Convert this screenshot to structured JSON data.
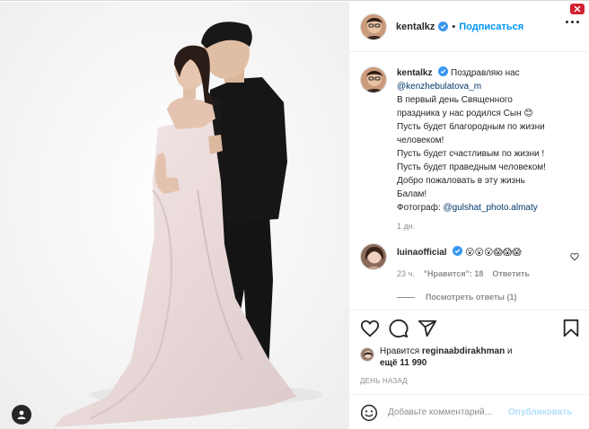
{
  "header": {
    "username": "kentalkz",
    "follow_label": "Подписаться",
    "separator": "•"
  },
  "caption": {
    "username": "kentalkz",
    "text_before_mention": "Поздравляю нас",
    "mention": "@kenzhebulatova_m",
    "lines": [
      "В первый день Священного",
      "праздника у нас родился Сын 😊",
      "Пусть будет благородным по жизни",
      "человеком!",
      "Пусть будет счастливым по жизни !",
      "Пусть будет праведным человеком!",
      "Добро пожаловать в эту жизнь",
      "Балам!"
    ],
    "photo_credit_label": "Фотограф:",
    "photo_credit_mention": "@gulshat_photo.almaty",
    "time": "1 дн."
  },
  "comment": {
    "username": "luinaofficial",
    "text": "😮😮😮😱😱😱",
    "time": "23 ч.",
    "likes": "\"Нравится\": 18",
    "reply_label": "Ответить",
    "view_replies": "Посмотреть ответы (1)"
  },
  "likes": {
    "prefix": "Нравится",
    "user": "reginaabdirakhman",
    "middle": "и",
    "more": "ещё 11 990"
  },
  "date": "ДЕНЬ НАЗАД",
  "add_comment": {
    "placeholder": "Добавьте комментарий...",
    "publish_label": "Опубликовать"
  },
  "colors": {
    "accent": "#0095f6",
    "verified": "#3897f0",
    "text": "#262626",
    "muted": "#8e8e8e"
  },
  "icons": [
    "heart-icon",
    "comment-icon",
    "share-icon",
    "bookmark-icon",
    "emoji-icon",
    "verified-icon",
    "more-icon",
    "user-tag-icon",
    "close-icon"
  ]
}
